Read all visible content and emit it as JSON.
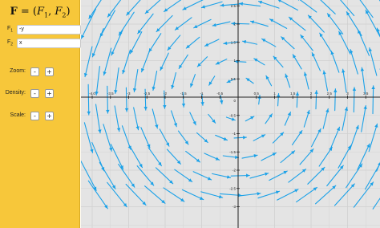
{
  "sidebar": {
    "formula": {
      "bold_F": "F",
      "eq": " = (",
      "f1": "F",
      "sub1": "1",
      "comma": ", ",
      "f2": "F",
      "sub2": "2",
      "close": ")"
    },
    "fields": [
      {
        "label": "F",
        "sub": "1",
        "value": "-y"
      },
      {
        "label": "F",
        "sub": "2",
        "value": "x"
      }
    ],
    "controls": [
      {
        "label": "Zoom:",
        "minus": "-",
        "plus": "+"
      },
      {
        "label": "Density:",
        "minus": "-",
        "plus": "+"
      },
      {
        "label": "Scale:",
        "minus": "-",
        "plus": "+"
      }
    ]
  },
  "plot": {
    "field": "F = (-y, x)",
    "xrange": [
      -4.2,
      4.2
    ],
    "yrange": [
      -3.1,
      3.1
    ],
    "x_ticks": [
      "-4.0",
      "-3.5",
      "-3",
      "-2.5",
      "-2",
      "-1.5",
      "-1",
      "-0.5",
      "0.5",
      "1",
      "1.5",
      "2",
      "2.5",
      "3",
      "3.5",
      "4"
    ],
    "y_ticks": [
      "3",
      "2.5",
      "2",
      "1.5",
      "1",
      "0.5",
      "-0.5",
      "-1",
      "-1.5",
      "-2",
      "-2.5",
      "-3"
    ],
    "origin_label": "0",
    "arrow_color": "#1aa1e8",
    "axis_color": "#222222",
    "grid": true,
    "background": "#e4e4e4"
  }
}
